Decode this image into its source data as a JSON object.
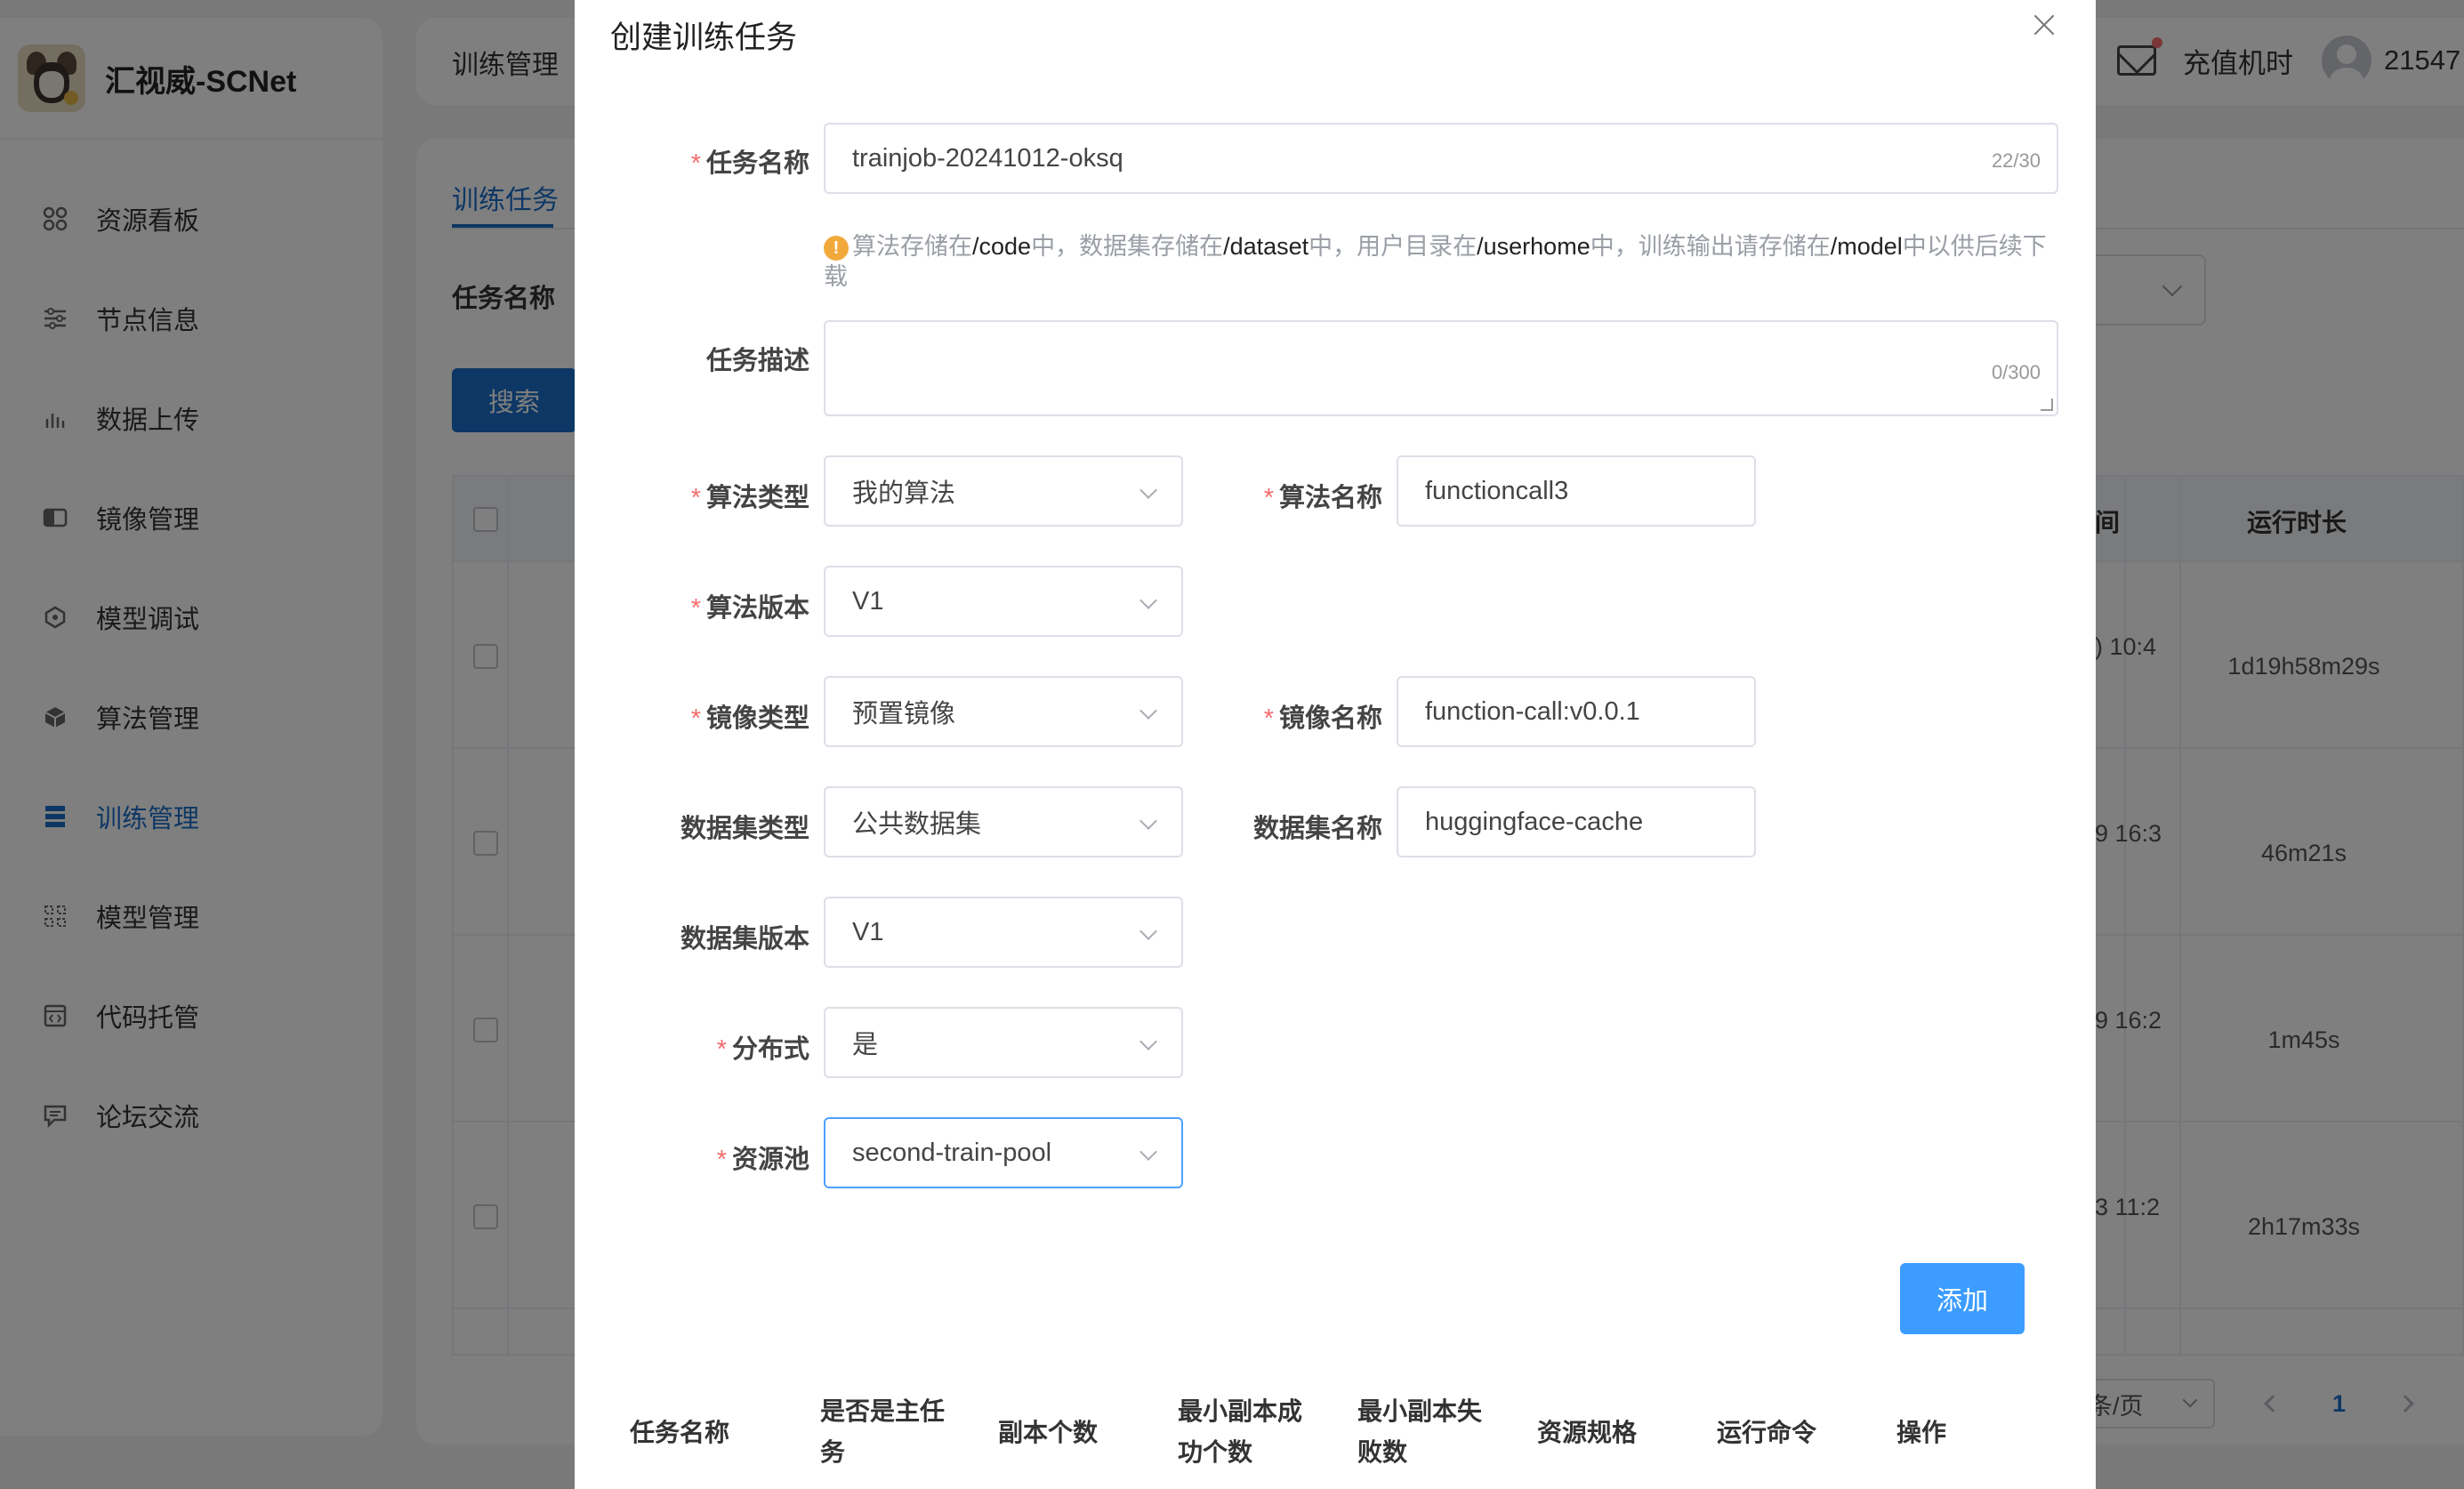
{
  "app": {
    "brand_name": "汇视威-SCNet"
  },
  "sidebar": {
    "items": [
      {
        "label": "资源看板",
        "icon": "dashboard-icon"
      },
      {
        "label": "节点信息",
        "icon": "sliders-icon"
      },
      {
        "label": "数据上传",
        "icon": "upload-chart-icon"
      },
      {
        "label": "镜像管理",
        "icon": "image-icon"
      },
      {
        "label": "模型调试",
        "icon": "debug-icon"
      },
      {
        "label": "算法管理",
        "icon": "cube-icon"
      },
      {
        "label": "训练管理",
        "icon": "list-icon",
        "active": true
      },
      {
        "label": "模型管理",
        "icon": "grid-icon"
      },
      {
        "label": "代码托管",
        "icon": "code-icon"
      },
      {
        "label": "论坛交流",
        "icon": "chat-icon"
      }
    ]
  },
  "header": {
    "breadcrumb": "训练管理",
    "recharge": "充值机时",
    "user": "21547"
  },
  "page": {
    "tab": "训练任务",
    "filter_label": "任务名称",
    "search_button": "搜索",
    "table": {
      "col_time_partial": "间",
      "col_duration": "运行时长",
      "rows": [
        {
          "time_partial": ") 10:4",
          "duration": "1d19h58m29s"
        },
        {
          "time_partial": "9 16:3",
          "duration": "46m21s"
        },
        {
          "time_partial": "9 16:2",
          "duration": "1m45s"
        },
        {
          "time_partial": "3 11:2",
          "duration": "2h17m33s"
        }
      ]
    },
    "pager": {
      "page_size": "条/页",
      "current_page": "1"
    }
  },
  "dialog": {
    "title": "创建训练任务",
    "task_name": {
      "label": "任务名称",
      "value": "trainjob-20241012-oksq",
      "count": "22/30"
    },
    "tip": {
      "parts": [
        "算法存储在",
        "/code",
        "中，数据集存储在",
        "/dataset",
        "中，用户目录在",
        "/userhome",
        "中，训练输出请存储在",
        "/model",
        "中以供后续下载"
      ]
    },
    "task_desc": {
      "label": "任务描述",
      "value": "",
      "count": "0/300"
    },
    "algo_type": {
      "label": "算法类型",
      "value": "我的算法"
    },
    "algo_name": {
      "label": "算法名称",
      "value": "functioncall3"
    },
    "algo_version": {
      "label": "算法版本",
      "value": "V1"
    },
    "image_type": {
      "label": "镜像类型",
      "value": "预置镜像"
    },
    "image_name": {
      "label": "镜像名称",
      "value": "function-call:v0.0.1"
    },
    "dataset_type": {
      "label": "数据集类型",
      "value": "公共数据集"
    },
    "dataset_name": {
      "label": "数据集名称",
      "value": "huggingface-cache"
    },
    "dataset_version": {
      "label": "数据集版本",
      "value": "V1"
    },
    "distributed": {
      "label": "分布式",
      "value": "是"
    },
    "resource_pool": {
      "label": "资源池",
      "value": "second-train-pool"
    },
    "add_button": "添加",
    "subtable_headers": [
      "任务名称",
      "是否是主任务",
      "副本个数",
      "最小副本成功个数",
      "最小副本失败数",
      "资源规格",
      "运行命令",
      "操作"
    ],
    "subtable_headers_display": [
      [
        "任务名称"
      ],
      [
        "是否是主任",
        "务"
      ],
      [
        "副本个数"
      ],
      [
        "最小副本成",
        "功个数"
      ],
      [
        "最小副本失",
        "败数"
      ],
      [
        "资源规格"
      ],
      [
        "运行命令"
      ],
      [
        "操作"
      ]
    ]
  },
  "colors": {
    "primary": "#1b6fc9",
    "button": "#3c9cff",
    "required": "#f56c6c",
    "warning": "#f2a93b",
    "overlay": "rgba(0,0,0,0.5)"
  }
}
